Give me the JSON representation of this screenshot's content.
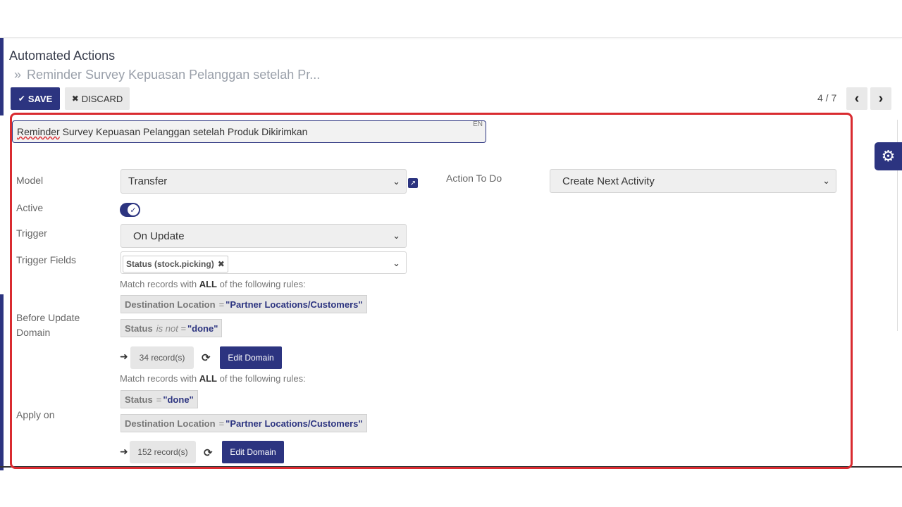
{
  "breadcrumb": {
    "root": "Automated Actions",
    "separator": "»",
    "current": "Reminder Survey Kepuasan Pelanggan setelah Pr..."
  },
  "toolbar": {
    "save_label": "SAVE",
    "discard_label": "DISCARD"
  },
  "pager": {
    "value": "4 / 7"
  },
  "form": {
    "name_first": "Reminder",
    "name_rest": " Survey Kepuasan Pelanggan setelah Produk Dikirimkan",
    "lang": "EN",
    "model_label": "Model",
    "model_value": "Transfer",
    "action_label": "Action To Do",
    "action_value": "Create Next Activity",
    "active_label": "Active",
    "active": true,
    "trigger_label": "Trigger",
    "trigger_value": "On Update",
    "trigger_fields_label": "Trigger Fields",
    "trigger_field_tag": "Status (stock.picking)",
    "before_label": "Before Update Domain",
    "apply_label": "Apply on"
  },
  "before_domain": {
    "match_prefix": "Match records with ",
    "match_bold": "ALL",
    "match_suffix": " of the following rules:",
    "rules": [
      {
        "field": "Destination Location",
        "op": "=",
        "value": "\"Partner Locations/Customers\""
      },
      {
        "field": "Status",
        "op": "is not =",
        "value": "\"done\""
      }
    ],
    "records": "34 record(s)",
    "edit_label": "Edit Domain"
  },
  "apply_domain": {
    "match_prefix": "Match records with ",
    "match_bold": "ALL",
    "match_suffix": " of the following rules:",
    "rules": [
      {
        "field": "Status",
        "op": "=",
        "value": "\"done\""
      },
      {
        "field": "Destination Location",
        "op": "=",
        "value": "\"Partner Locations/Customers\""
      }
    ],
    "records": "152 record(s)",
    "edit_label": "Edit Domain"
  },
  "colors": {
    "primary": "#2c3480",
    "highlight": "#d92b30"
  }
}
